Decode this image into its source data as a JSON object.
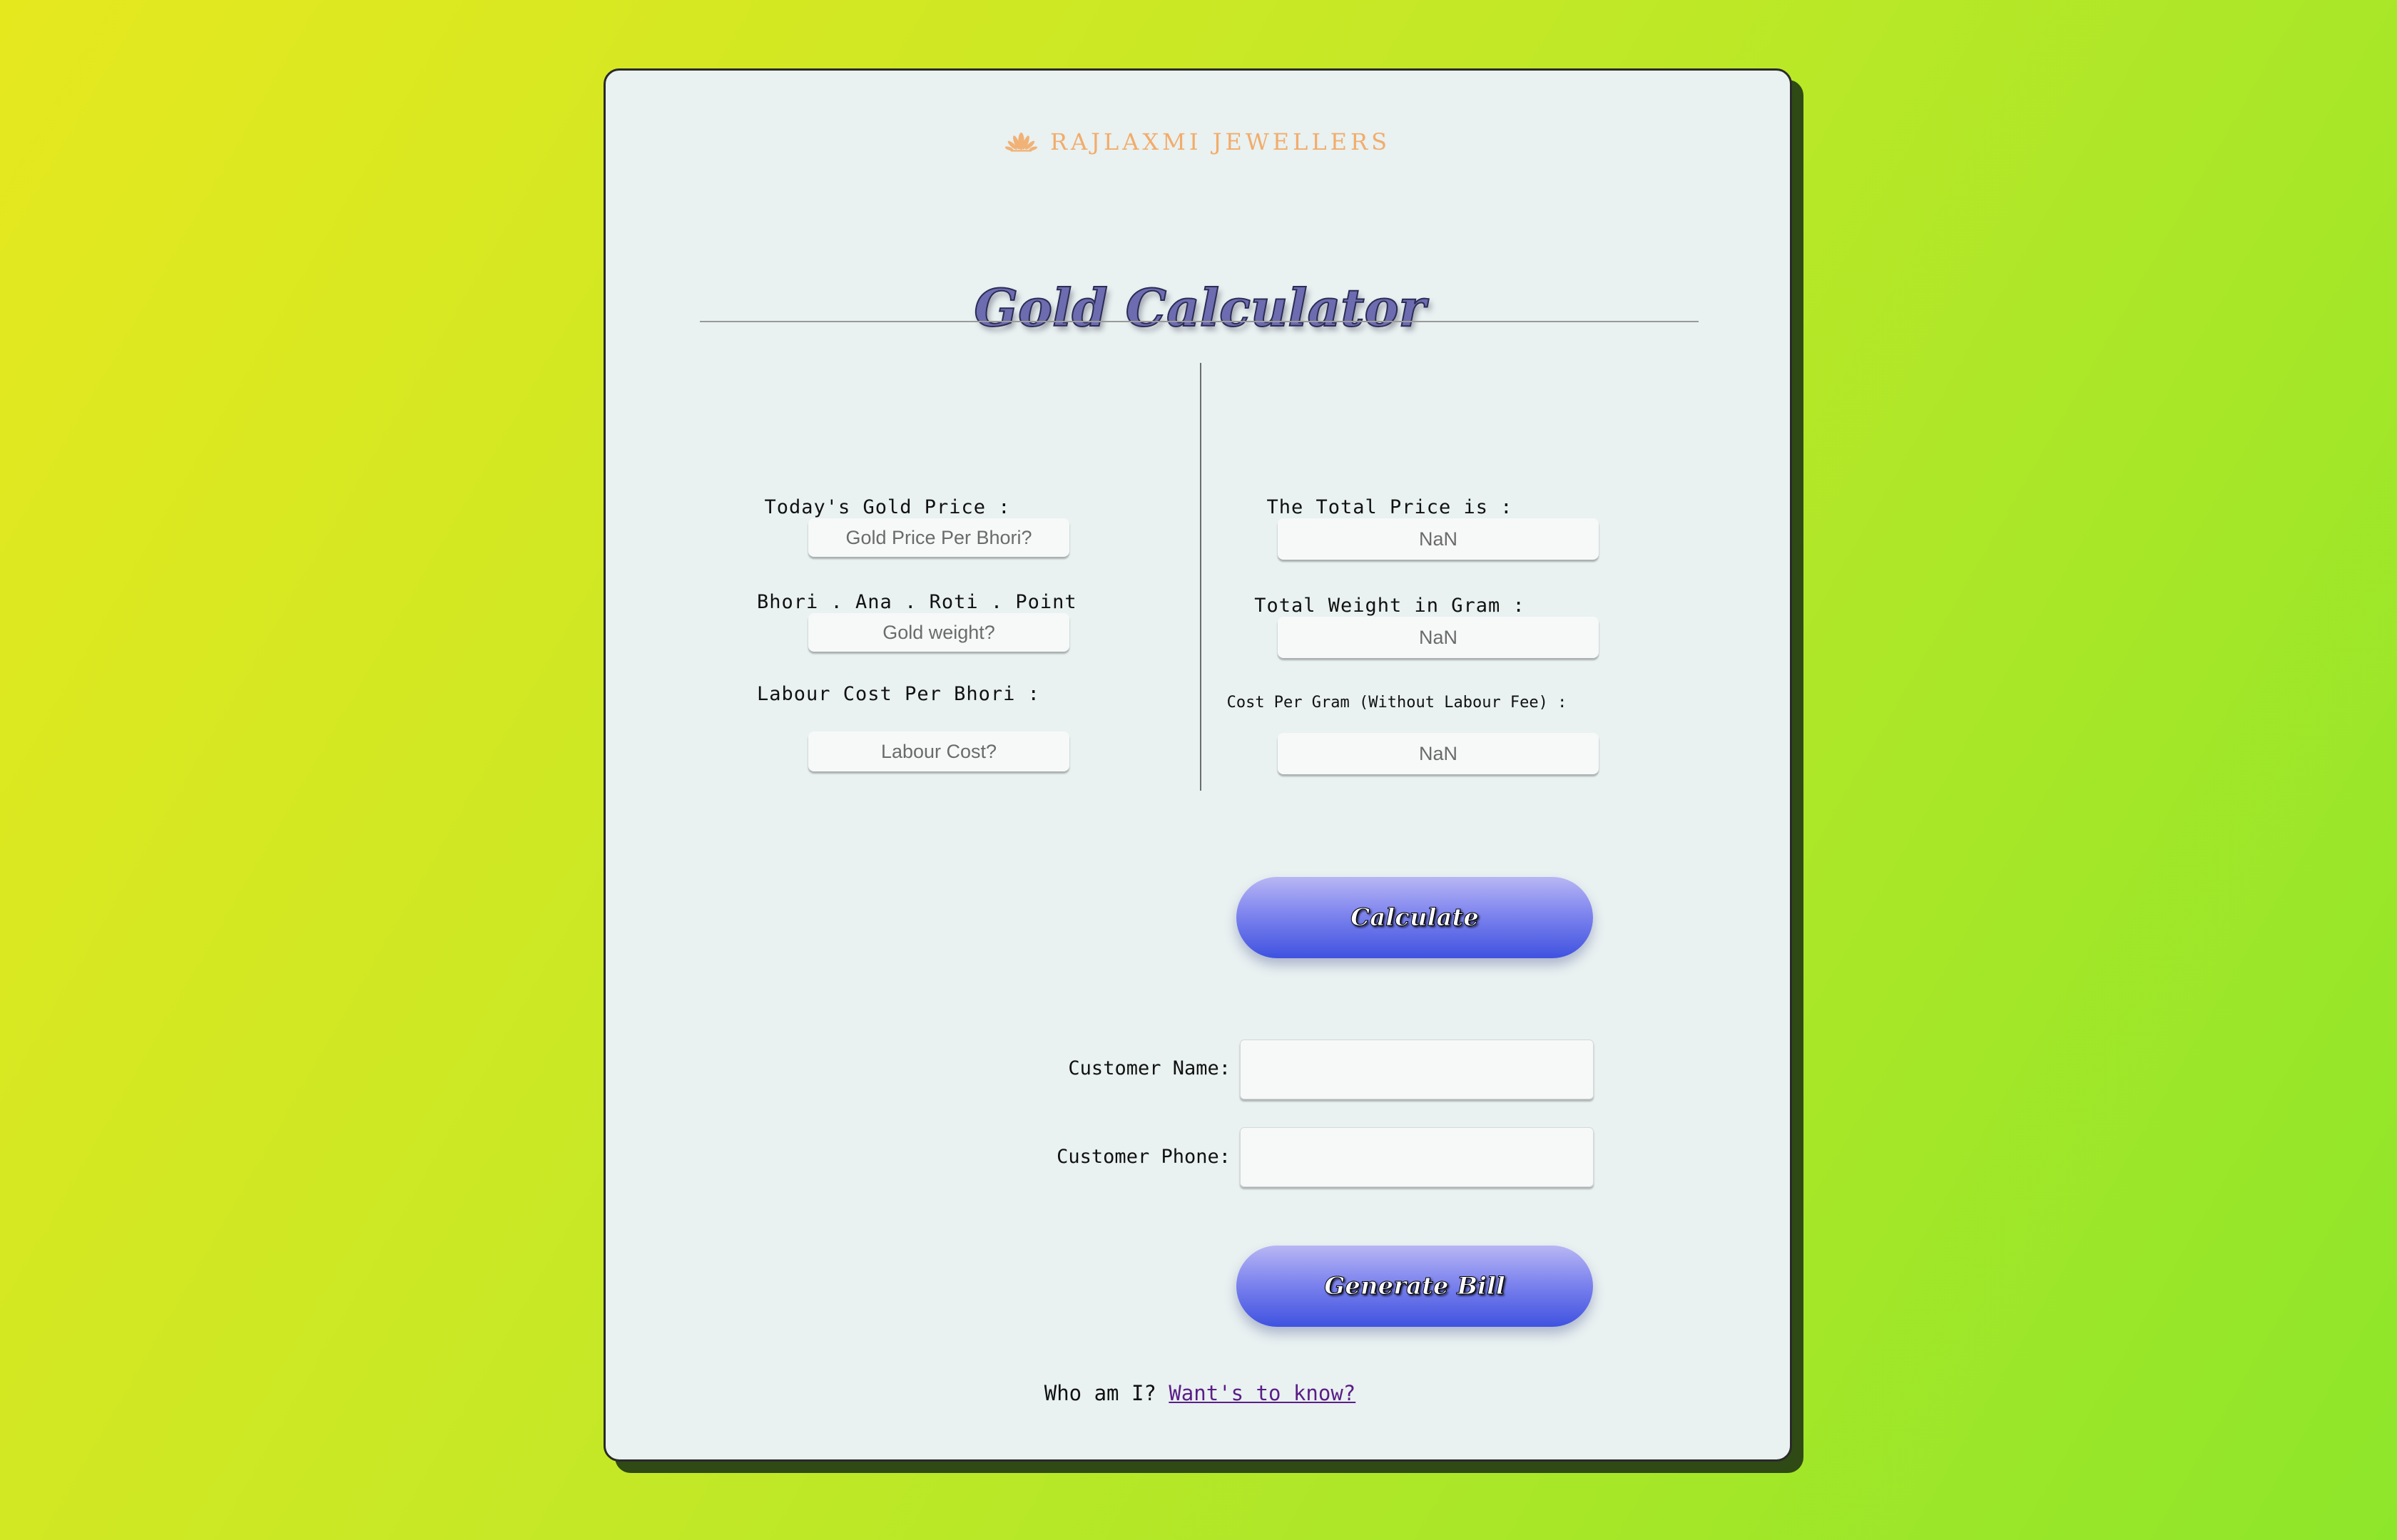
{
  "brand": {
    "name": "RAJLAXMI JEWELLERS",
    "icon": "lotus-icon",
    "color": "#f2ac6a"
  },
  "title": "Gold Calculator",
  "inputs": {
    "gold_price": {
      "label": "Today's Gold Price :",
      "placeholder": "Gold Price Per Bhori?"
    },
    "gold_weight": {
      "label": "Bhori . Ana . Roti . Point",
      "placeholder": "Gold weight?"
    },
    "labour_cost": {
      "label": "Labour Cost Per Bhori :",
      "placeholder": "Labour Cost?"
    }
  },
  "outputs": {
    "total_price": {
      "label": "The Total Price is :",
      "value": "NaN"
    },
    "total_weight": {
      "label": "Total Weight in Gram :",
      "value": "NaN"
    },
    "cost_per_gram": {
      "label": "Cost Per Gram (Without Labour Fee) :",
      "value": "NaN"
    }
  },
  "buttons": {
    "calculate": "Calculate",
    "generate_bill": "Generate Bill"
  },
  "customer": {
    "name_label": "Customer Name:",
    "phone_label": "Customer Phone:",
    "name_value": "",
    "phone_value": ""
  },
  "footer": {
    "text": "Who am I?",
    "link": "Want's to know?"
  },
  "colors": {
    "accent": "#4a5ae2",
    "link": "#5a1e86",
    "card_bg": "#e9f1f1"
  }
}
